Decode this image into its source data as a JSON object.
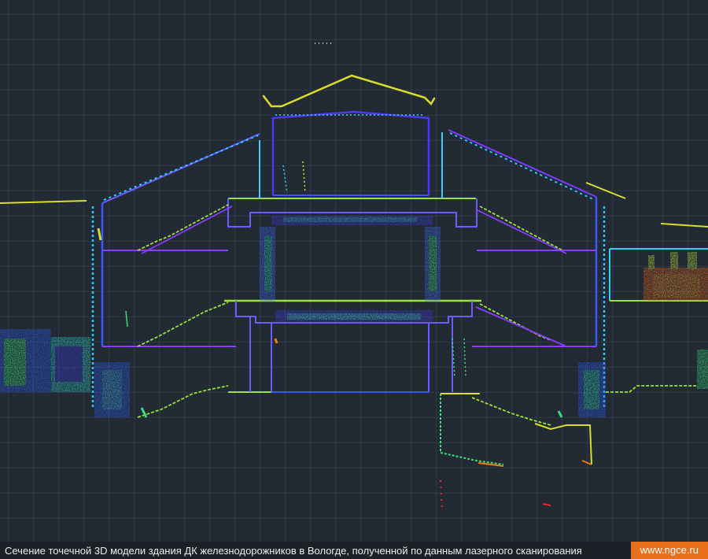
{
  "caption": {
    "text": "Сечение точечной 3D модели здания ДК железнодорожников в Вологде, полученной по данным лазерного сканирования",
    "site": "www.ngce.ru"
  },
  "colors": {
    "background": "#222a33",
    "badge": "#e86f1c",
    "caption_bar": "#1d2127"
  }
}
